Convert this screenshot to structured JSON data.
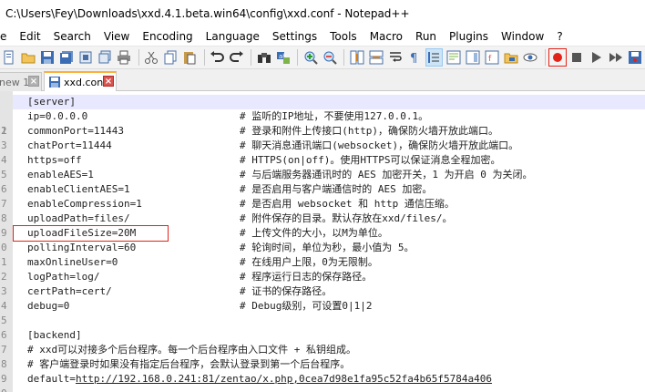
{
  "window": {
    "title": "C:\\Users\\Fey\\Downloads\\xxd.4.1.beta.win64\\config\\xxd.conf - Notepad++"
  },
  "menu": [
    "e",
    "Edit",
    "Search",
    "View",
    "Encoding",
    "Language",
    "Settings",
    "Tools",
    "Macro",
    "Run",
    "Plugins",
    "Window",
    "?"
  ],
  "tabs": {
    "inactive": {
      "label": "new 1"
    },
    "active": {
      "label": "xxd.conf"
    }
  },
  "lines": [
    {
      "num": "1",
      "code": "[server]",
      "comment": ""
    },
    {
      "num": "2",
      "code": "ip=0.0.0.0",
      "comment": "# 监听的IP地址，不要使用127.0.0.1。"
    },
    {
      "num": "3",
      "code": "commonPort=11443",
      "comment": "# 登录和附件上传接口(http)，确保防火墙开放此端口。"
    },
    {
      "num": "4",
      "code": "chatPort=11444",
      "comment": "# 聊天消息通讯端口(websocket)，确保防火墙开放此端口。"
    },
    {
      "num": "5",
      "code": "https=off",
      "comment": "# HTTPS(on|off)。使用HTTPS可以保证消息全程加密。"
    },
    {
      "num": "6",
      "code": "enableAES=1",
      "comment": "# 与后端服务器通讯时的 AES 加密开关，1 为开启 0 为关闭。"
    },
    {
      "num": "7",
      "code": "enableClientAES=1",
      "comment": "# 是否启用与客户端通信时的 AES 加密。"
    },
    {
      "num": "8",
      "code": "enableCompression=1",
      "comment": "# 是否启用 websocket 和 http 通信压缩。"
    },
    {
      "num": "9",
      "code": "uploadPath=files/",
      "comment": "# 附件保存的目录。默认存放在xxd/files/。"
    },
    {
      "num": "0",
      "code": "uploadFileSize=20M",
      "comment": "# 上传文件的大小，以M为单位。"
    },
    {
      "num": "1",
      "code": "pollingInterval=60",
      "comment": "# 轮询时间，单位为秒，最小值为 5。"
    },
    {
      "num": "2",
      "code": "maxOnlineUser=0",
      "comment": "# 在线用户上限，0为无限制。"
    },
    {
      "num": "3",
      "code": "logPath=log/",
      "comment": "# 程序运行日志的保存路径。"
    },
    {
      "num": "4",
      "code": "certPath=cert/",
      "comment": "# 证书的保存路径。"
    },
    {
      "num": "5",
      "code": "debug=0",
      "comment": "# Debug级别，可设置0|1|2"
    },
    {
      "num": "6",
      "code": "",
      "comment": ""
    },
    {
      "num": "7",
      "code": "[backend]",
      "comment": ""
    },
    {
      "num": "8",
      "code": "# xxd可以对接多个后台程序。每一个后台程序由入口文件 + 私钥组成。",
      "comment": ""
    },
    {
      "num": "9",
      "code": "# 客户端登录时如果没有指定后台程序，会默认登录到第一个后台程序。",
      "comment": ""
    },
    {
      "num": "0",
      "code": "default=",
      "url": "http://192.168.0.241:81/zentao/x.php,0cea7d98e1fa95c52fa4b65f5784a406",
      "comment": ""
    }
  ],
  "colors": {
    "accent_tab": "#fbb03b",
    "highlight_box": "#e2231a",
    "current_line": "#e8e8ff"
  }
}
